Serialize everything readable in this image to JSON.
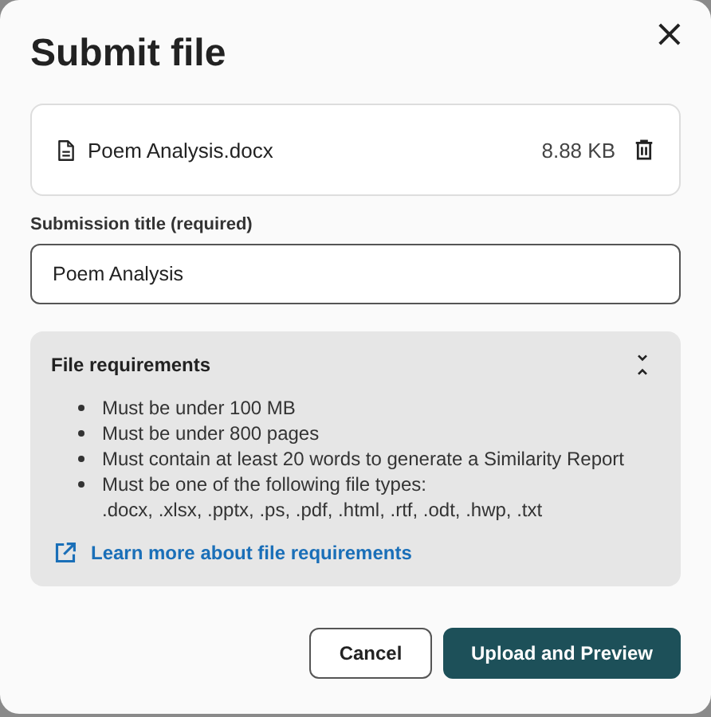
{
  "dialog": {
    "title": "Submit file",
    "close": "×"
  },
  "file": {
    "name": "Poem Analysis.docx",
    "size": "8.88 KB"
  },
  "title_field": {
    "label": "Submission title (required)",
    "value": "Poem Analysis"
  },
  "requirements": {
    "title": "File requirements",
    "expanded": true,
    "items": [
      {
        "text": "Must be under 100 MB"
      },
      {
        "text": "Must be under 800 pages"
      },
      {
        "text": "Must contain at least 20 words to generate a Similarity Report"
      },
      {
        "text": "Must be one of the following file types:",
        "detail": ".docx, .xlsx, .pptx, .ps, .pdf, .html, .rtf, .odt, .hwp, .txt"
      }
    ],
    "link": "Learn more about file requirements"
  },
  "buttons": [
    {
      "label": "Cancel",
      "kind": "secondary"
    },
    {
      "label": "Upload and Preview",
      "kind": "primary"
    }
  ]
}
